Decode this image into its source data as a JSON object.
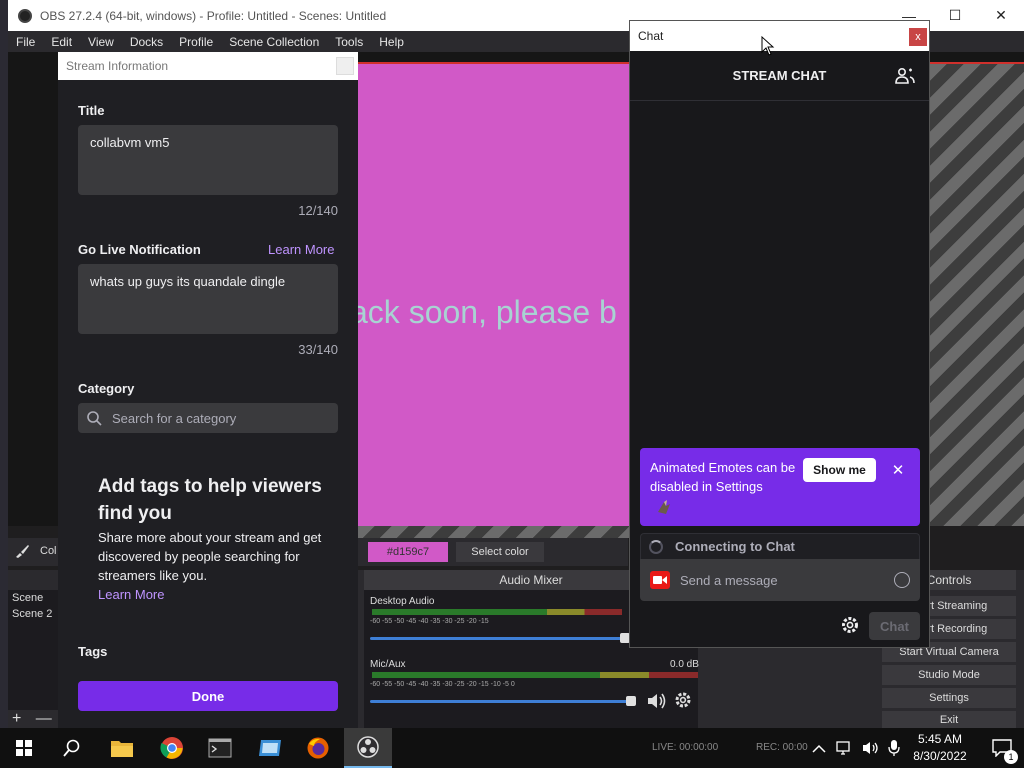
{
  "obs": {
    "window_title": "OBS 27.2.4 (64-bit, windows) - Profile: Untitled - Scenes: Untitled",
    "window_controls": {
      "minimize": "—",
      "maximize": "☐",
      "close": "✕"
    },
    "menu": [
      "File",
      "Edit",
      "View",
      "Docks",
      "Profile",
      "Scene Collection",
      "Tools",
      "Help"
    ],
    "preview_text": "ack soon, please b",
    "color_label": "Col",
    "color_value": "#d159c7",
    "select_color": "Select color",
    "scenes": [
      "Scene",
      "Scene 2"
    ],
    "scene_tools": {
      "add": "+",
      "remove": "—"
    },
    "mixer": {
      "title": "Audio Mixer",
      "tracks": [
        {
          "name": "Desktop Audio",
          "db": "",
          "scale": "-60  -55  -50  -45  -40  -35  -30  -25  -20  -15"
        },
        {
          "name": "Mic/Aux",
          "db": "0.0 dB",
          "scale": "-60  -55  -50  -45  -40  -35  -30  -25  -20  -15  -10   -5    0"
        }
      ]
    },
    "controls": {
      "title": "Controls",
      "buttons": [
        "Start Streaming",
        "Start Recording",
        "Start Virtual Camera",
        "Studio Mode",
        "Settings",
        "Exit"
      ]
    },
    "status": {
      "live": "LIVE: 00:00:00",
      "rec": "REC: 00:00"
    }
  },
  "stream_info": {
    "window_title": "Stream Information",
    "title_label": "Title",
    "title_value": "collabvm vm5",
    "title_count": "12/140",
    "notification_label": "Go Live Notification",
    "learn_more": "Learn More",
    "notification_value": "whats up guys its quandale dingle",
    "notification_count": "33/140",
    "category_label": "Category",
    "category_placeholder": "Search for a category",
    "tags_heading": "Add tags to help viewers find you",
    "tags_desc": "Share more about your stream and get discovered by people searching for streamers like you.",
    "tags_learn_more": "Learn More",
    "tags_label": "Tags",
    "done": "Done"
  },
  "chat": {
    "window_title": "Chat",
    "close": "x",
    "header": "STREAM CHAT",
    "promo_text": "Animated Emotes can be disabled in Settings",
    "promo_button": "Show me",
    "promo_close": "✕",
    "connecting": "Connecting to Chat",
    "message_placeholder": "Send a message",
    "send": "Chat"
  },
  "taskbar": {
    "time": "5:45 AM",
    "date": "8/30/2022",
    "notification_count": "1"
  },
  "colors": {
    "pink_canvas": "#d159c7",
    "twitch_purple": "#772ce8",
    "link_purple": "#bf94ff"
  }
}
